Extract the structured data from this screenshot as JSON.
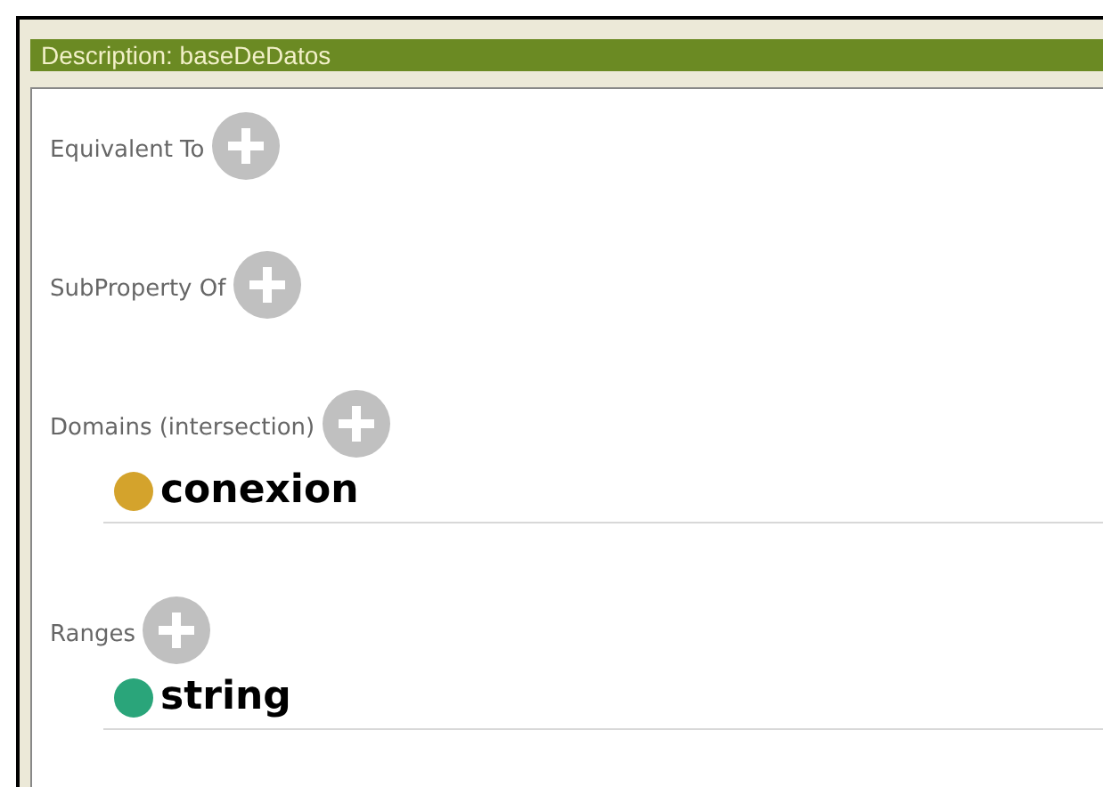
{
  "header": {
    "title": "Description: baseDeDatos"
  },
  "sections": [
    {
      "label": "Equivalent To"
    },
    {
      "label": "SubProperty Of"
    },
    {
      "label": "Domains (intersection)",
      "items": [
        {
          "name": "conexion",
          "color": "#d4a32c"
        }
      ]
    },
    {
      "label": "Ranges",
      "items": [
        {
          "name": "string",
          "color": "#2aa57a"
        }
      ]
    }
  ]
}
